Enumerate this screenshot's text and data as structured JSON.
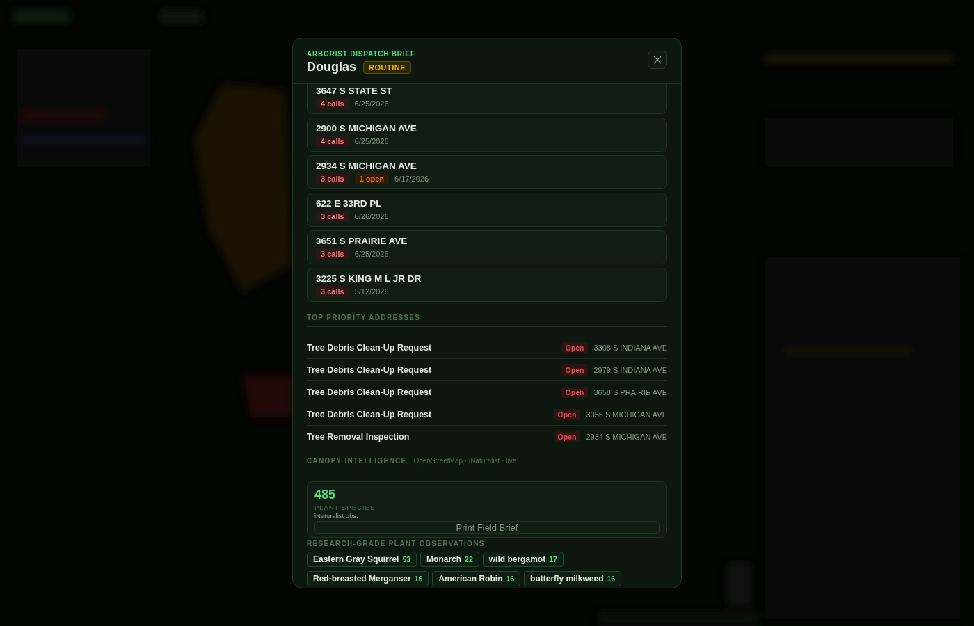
{
  "modal": {
    "eyebrow": "ARBORIST DISPATCH BRIEF",
    "title": "Douglas",
    "priority": {
      "label": "ROUTINE",
      "kind": "routine"
    }
  },
  "hotspots": [
    {
      "address": "3647 S STATE ST",
      "badges": [
        {
          "label": "4 calls",
          "kind": "calls"
        }
      ],
      "date": "6/25/2026"
    },
    {
      "address": "2900 S MICHIGAN AVE",
      "badges": [
        {
          "label": "4 calls",
          "kind": "calls"
        }
      ],
      "date": "6/25/2026"
    },
    {
      "address": "2934 S MICHIGAN AVE",
      "badges": [
        {
          "label": "3 calls",
          "kind": "calls"
        },
        {
          "label": "1 open",
          "kind": "open"
        }
      ],
      "date": "6/17/2026"
    },
    {
      "address": "622 E 33RD PL",
      "badges": [
        {
          "label": "3 calls",
          "kind": "calls"
        }
      ],
      "date": "6/26/2026"
    },
    {
      "address": "3651 S PRAIRIE AVE",
      "badges": [
        {
          "label": "3 calls",
          "kind": "calls"
        }
      ],
      "date": "6/25/2026"
    },
    {
      "address": "3225 S KING M L JR DR",
      "badges": [
        {
          "label": "3 calls",
          "kind": "calls"
        }
      ],
      "date": "5/12/2026"
    }
  ],
  "top_priority": {
    "heading": "TOP PRIORITY ADDRESSES",
    "rows": [
      {
        "request": "Tree Debris Clean-Up Request",
        "status": "Open",
        "address": "3308 S INDIANA AVE"
      },
      {
        "request": "Tree Debris Clean-Up Request",
        "status": "Open",
        "address": "2979 S INDIANA AVE"
      },
      {
        "request": "Tree Debris Clean-Up Request",
        "status": "Open",
        "address": "3658 S PRAIRIE AVE"
      },
      {
        "request": "Tree Debris Clean-Up Request",
        "status": "Open",
        "address": "3056 S MICHIGAN AVE"
      },
      {
        "request": "Tree Removal Inspection",
        "status": "Open",
        "address": "2934 S MICHIGAN AVE"
      }
    ]
  },
  "canopy": {
    "heading": "CANOPY INTELLIGENCE",
    "sources": "OpenStreetMap · iNaturalist · live",
    "stat": {
      "value": "485",
      "label": "PLANT SPECIES",
      "note": "iNaturalist obs."
    },
    "print_button": "Print Field Brief",
    "observations_heading": "RESEARCH-GRADE PLANT OBSERVATIONS",
    "observations": [
      {
        "name": "Eastern Gray Squirrel",
        "count": "53"
      },
      {
        "name": "Monarch",
        "count": "22"
      },
      {
        "name": "wild bergamot",
        "count": "17"
      },
      {
        "name": "Red-breasted Merganser",
        "count": "16"
      },
      {
        "name": "American Robin",
        "count": "16"
      },
      {
        "name": "butterfly milkweed",
        "count": "16"
      }
    ]
  }
}
